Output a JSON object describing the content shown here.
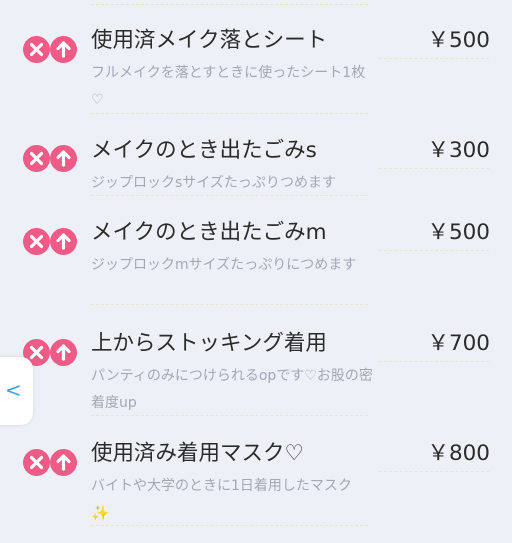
{
  "colors": {
    "background": "#eef0f7",
    "action_button": "#ee5b86",
    "title_text": "#2b2b2b",
    "description_text": "#a4a7b4",
    "dashed_rule": "#e6e7cf",
    "side_tab_arrow": "#3aa3e0"
  },
  "icons": {
    "delete": "close-x-icon",
    "move_up": "arrow-up-icon",
    "side_tab": "chevron-left-icon",
    "sparkle": "sparkle-icon"
  },
  "side_tab": {
    "arrow": "<"
  },
  "items": [
    {
      "title": "使用済メイク落とシート",
      "price": "￥500",
      "description": "フルメイクを落とすときに使ったシート1枚♡"
    },
    {
      "title": "メイクのとき出たごみs",
      "price": "￥300",
      "description": "ジップロックsサイズたっぷりつめます"
    },
    {
      "title": "メイクのとき出たごみm",
      "price": "￥500",
      "description": "ジップロックmサイズたっぷりにつめます"
    },
    {
      "title": "上からストッキング着用",
      "price": "￥700",
      "description": "パンティのみにつけられるopです♡お股の密着度up"
    },
    {
      "title": "使用済み着用マスク♡",
      "price": "￥800",
      "description": "バイトや大学のときに1日着用したマスク",
      "description_emoji": "✨"
    }
  ]
}
